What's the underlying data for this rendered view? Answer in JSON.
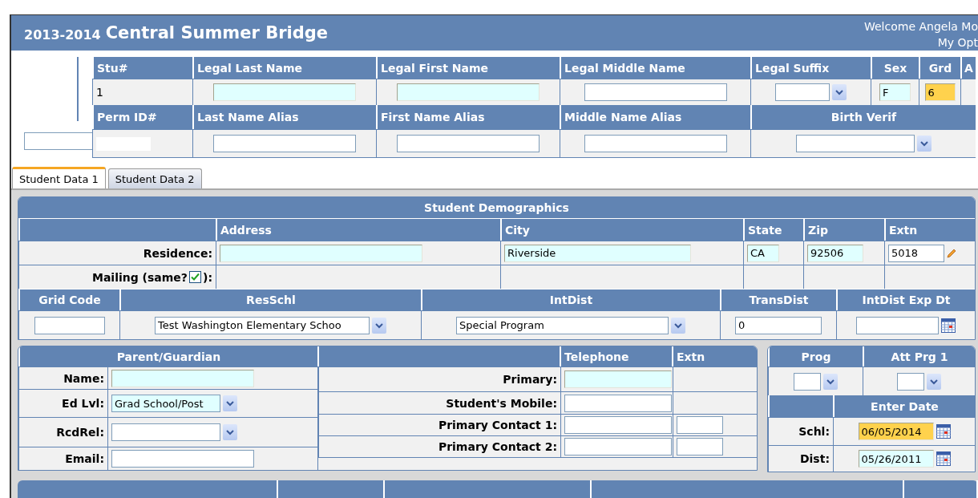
{
  "app_bar": {
    "year": "2013-2014",
    "title": "Central Summer Bridge",
    "welcome": "Welcome Angela Mo",
    "options_link": "My Opt"
  },
  "student": {
    "side_field": {
      "kind": "text",
      "prefilled": false,
      "flagged": false
    },
    "rows": [
      {
        "cells": [
          {
            "label": "Stu#",
            "field": {
              "kind": "static",
              "value": "1"
            }
          },
          {
            "label": "Legal Last Name",
            "field": {
              "kind": "text",
              "prefilled": true,
              "flagged": false
            }
          },
          {
            "label": "Legal First Name",
            "field": {
              "kind": "text",
              "prefilled": true,
              "flagged": false
            }
          },
          {
            "label": "Legal Middle Name",
            "field": {
              "kind": "text",
              "prefilled": false,
              "flagged": false
            }
          },
          {
            "label": "Legal Suffix",
            "field": {
              "kind": "select",
              "prefilled": false,
              "flagged": false
            }
          },
          {
            "label": "Sex",
            "field": {
              "kind": "text",
              "value": "F",
              "prefilled": true,
              "flagged": false
            }
          },
          {
            "label": "Grd",
            "field": {
              "kind": "text",
              "value": "6",
              "prefilled": true,
              "flagged": true
            }
          },
          {
            "label": "A"
          }
        ]
      },
      {
        "cells": [
          {
            "label": "Perm ID#",
            "field": {
              "kind": "blank"
            }
          },
          {
            "label": "Last Name Alias",
            "field": {
              "kind": "text",
              "prefilled": false,
              "flagged": false
            }
          },
          {
            "label": "First Name Alias",
            "field": {
              "kind": "text",
              "prefilled": false,
              "flagged": false
            }
          },
          {
            "label": "Middle Name Alias",
            "field": {
              "kind": "text",
              "prefilled": false,
              "flagged": false
            }
          },
          {
            "label": "Birth Verif",
            "field": {
              "kind": "select",
              "prefilled": false,
              "flagged": false
            }
          }
        ]
      }
    ]
  },
  "tabs": [
    {
      "label": "Student Data 1",
      "selected": true
    },
    {
      "label": "Student Data 2",
      "selected": false
    }
  ],
  "demographics": {
    "title": "Student Demographics",
    "columns": [
      "Address",
      "City",
      "State",
      "Zip",
      "Extn"
    ],
    "rows": [
      {
        "label": "Residence:",
        "fields": [
          {
            "kind": "text",
            "prefilled": true,
            "flagged": false
          },
          {
            "kind": "text",
            "value": "Riverside",
            "prefilled": true,
            "flagged": false
          },
          {
            "kind": "text",
            "value": "CA",
            "prefilled": true,
            "flagged": false
          },
          {
            "kind": "text",
            "value": "92506",
            "prefilled": true,
            "flagged": false
          },
          {
            "kind": "edit",
            "value": "5018",
            "prefilled": false,
            "flagged": false
          }
        ]
      },
      {
        "label": "Mailing (same?",
        "label_end": "):",
        "checked": true,
        "fields": []
      }
    ],
    "district": [
      {
        "label": "Grid Code",
        "field": {
          "kind": "text",
          "prefilled": false,
          "flagged": false
        }
      },
      {
        "label": "ResSchl",
        "field": {
          "kind": "select",
          "value": "Test Washington Elementary Schoo",
          "prefilled": false,
          "flagged": false
        }
      },
      {
        "label": "IntDist",
        "field": {
          "kind": "select",
          "value": "Special Program",
          "prefilled": false,
          "flagged": false
        }
      },
      {
        "label": "TransDist",
        "field": {
          "kind": "text",
          "value": "0",
          "prefilled": false,
          "flagged": false
        }
      },
      {
        "label": "IntDist Exp Dt",
        "field": {
          "kind": "date",
          "prefilled": false,
          "flagged": false
        }
      }
    ]
  },
  "parent": {
    "title": "Parent/Guardian",
    "rows": [
      {
        "label": "Name:",
        "field": {
          "kind": "text",
          "prefilled": true,
          "flagged": false
        }
      },
      {
        "label": "Ed Lvl:",
        "field": {
          "kind": "select",
          "value": "Grad School/Post",
          "prefilled": true,
          "flagged": false
        }
      },
      {
        "label": "RcdRel:",
        "field": {
          "kind": "select",
          "prefilled": false,
          "flagged": false
        }
      },
      {
        "label": "Email:",
        "field": {
          "kind": "text",
          "prefilled": false,
          "flagged": false
        }
      }
    ],
    "phone_columns": [
      "Telephone",
      "Extn"
    ],
    "phones": [
      {
        "label": "Primary:",
        "number": {
          "kind": "text",
          "prefilled": true,
          "flagged": false
        }
      },
      {
        "label": "Student's Mobile:",
        "number": {
          "kind": "text",
          "prefilled": false,
          "flagged": false
        }
      },
      {
        "label": "Primary Contact 1:",
        "number": {
          "kind": "text",
          "prefilled": false,
          "flagged": false
        },
        "extension": {
          "kind": "text",
          "prefilled": false,
          "flagged": false
        }
      },
      {
        "label": "Primary Contact 2:",
        "number": {
          "kind": "text",
          "prefilled": false,
          "flagged": false
        },
        "extension": {
          "kind": "text",
          "prefilled": false,
          "flagged": false
        }
      }
    ]
  },
  "programs": {
    "columns": [
      {
        "label": "Prog",
        "field": {
          "kind": "select",
          "prefilled": false,
          "flagged": false
        }
      },
      {
        "label": "Att Prg 1",
        "field": {
          "kind": "select",
          "prefilled": false,
          "flagged": false
        }
      }
    ],
    "dates_title": "Enter Date",
    "dates": [
      {
        "label": "Schl:",
        "field": {
          "kind": "date",
          "value": "06/05/2014",
          "prefilled": true,
          "flagged": true
        }
      },
      {
        "label": "Dist:",
        "field": {
          "kind": "date",
          "value": "05/26/2011",
          "prefilled": true,
          "flagged": false
        }
      }
    ]
  }
}
